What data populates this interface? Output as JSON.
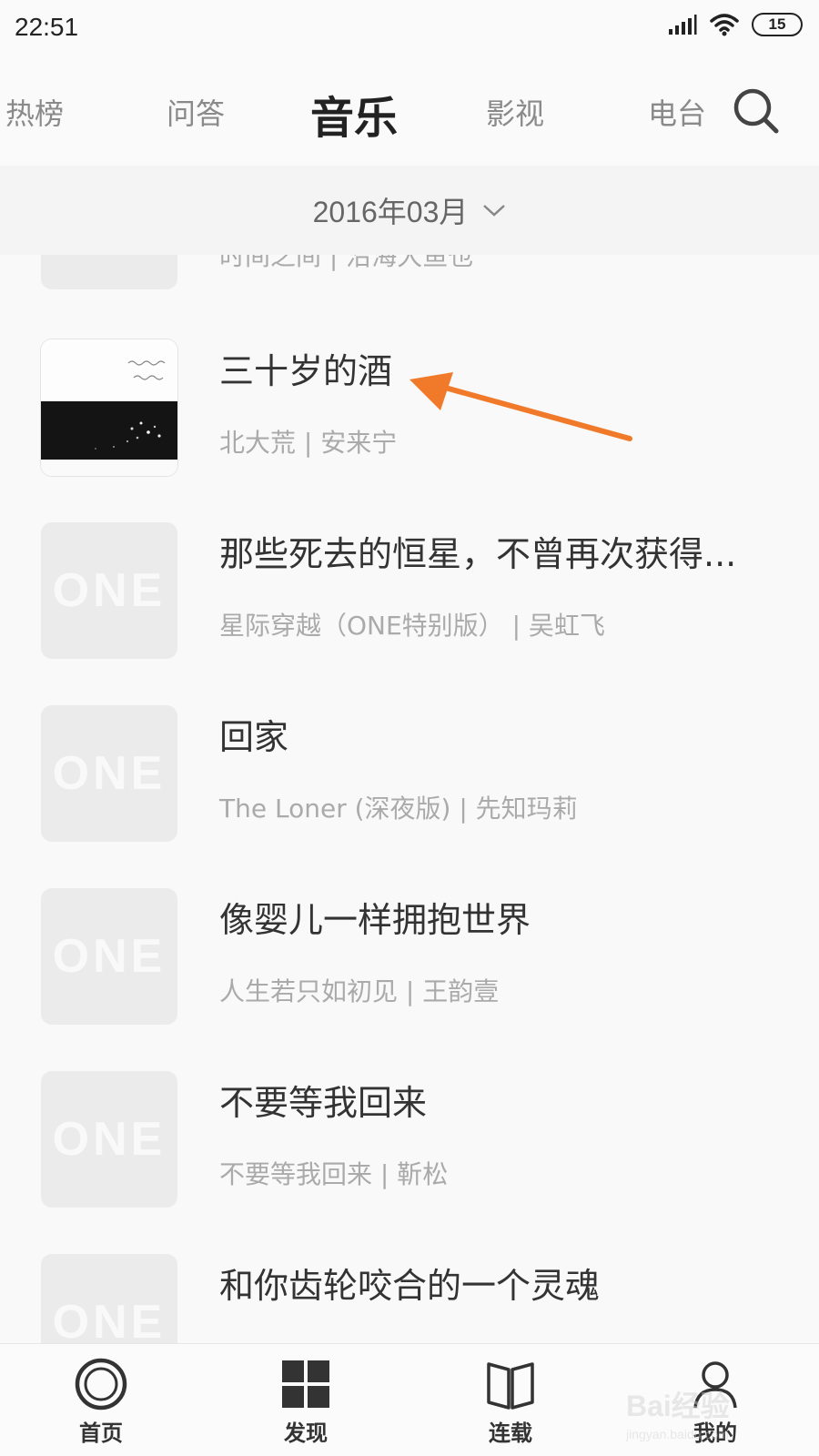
{
  "status_bar": {
    "time": "22:51",
    "battery": "15",
    "icons": [
      "signal-icon",
      "wifi-icon",
      "battery-icon"
    ]
  },
  "top_nav": {
    "tabs": [
      {
        "label": "热榜",
        "active": false
      },
      {
        "label": "问答",
        "active": false
      },
      {
        "label": "音乐",
        "active": true
      },
      {
        "label": "影视",
        "active": false
      },
      {
        "label": "电台",
        "active": false
      }
    ],
    "search_icon": "search-icon"
  },
  "date_filter": {
    "label": "2016年03月",
    "icon": "chevron-down-icon"
  },
  "songs": [
    {
      "title": "",
      "meta": "时间之间 | 沿海大鱼也",
      "cover": "one-placeholder"
    },
    {
      "title": "三十岁的酒",
      "meta": "北大荒 | 安来宁",
      "cover": "album-photo"
    },
    {
      "title": "那些死去的恒星，不曾再次获得...",
      "meta": "星际穿越（ONE特别版） | 吴虹飞",
      "cover": "one-placeholder"
    },
    {
      "title": "回家",
      "meta": "The Loner (深夜版) | 先知玛莉",
      "cover": "one-placeholder"
    },
    {
      "title": "像婴儿一样拥抱世界",
      "meta": "人生若只如初见 | 王韵壹",
      "cover": "one-placeholder"
    },
    {
      "title": "不要等我回来",
      "meta": "不要等我回来 | 靳松",
      "cover": "one-placeholder"
    },
    {
      "title": "和你齿轮咬合的一个灵魂",
      "meta": "",
      "cover": "one-placeholder"
    }
  ],
  "cover_placeholder_text": "ONE",
  "annotation": {
    "arrow_color": "#f07a2a"
  },
  "bottom_nav": {
    "items": [
      {
        "label": "首页",
        "icon": "home-ring-icon"
      },
      {
        "label": "发现",
        "icon": "grid-icon"
      },
      {
        "label": "连载",
        "icon": "book-icon"
      },
      {
        "label": "我的",
        "icon": "profile-icon"
      }
    ]
  },
  "watermark": {
    "main": "Bai经验",
    "sub": "jingyan.baidu.com"
  }
}
